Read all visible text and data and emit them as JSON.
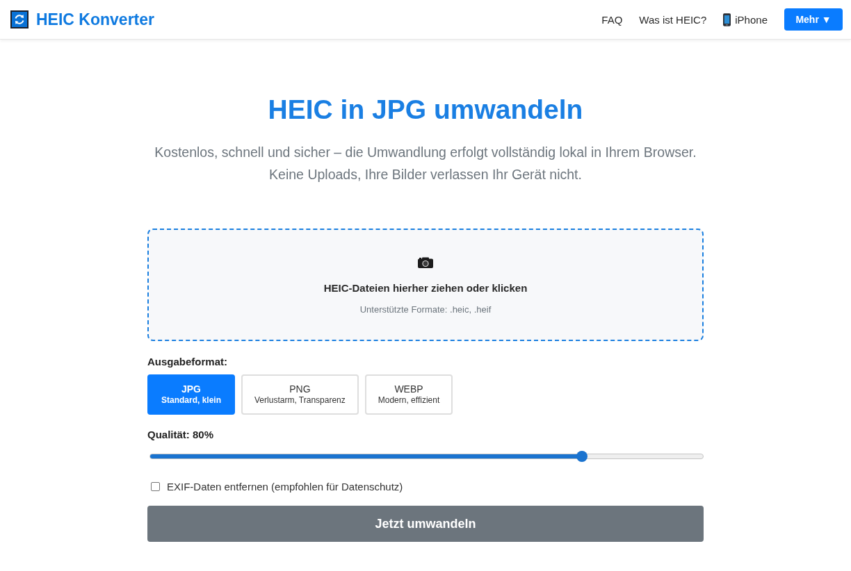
{
  "header": {
    "title": "HEIC Konverter",
    "nav": [
      {
        "label": "FAQ",
        "kind": "link"
      },
      {
        "label": "Was ist HEIC?",
        "kind": "link"
      },
      {
        "label": "iPhone",
        "kind": "phone-link"
      },
      {
        "label": "Mehr ▼",
        "kind": "button"
      }
    ]
  },
  "hero": {
    "title": "HEIC in JPG umwandeln",
    "subtitle": "Kostenlos, schnell und sicher – die Umwandlung erfolgt vollständig lokal in Ihrem Browser. Keine Uploads, Ihre Bilder verlassen Ihr Gerät nicht."
  },
  "dropzone": {
    "title": "HEIC-Dateien hierher ziehen oder klicken",
    "hint": "Unterstützte Formate: .heic, .heif"
  },
  "output_format": {
    "label": "Ausgabeformat:",
    "options": [
      {
        "name": "JPG",
        "description": "Standard, klein",
        "selected": true
      },
      {
        "name": "PNG",
        "description": "Verlustarm, Transparenz",
        "selected": false
      },
      {
        "name": "WEBP",
        "description": "Modern, effizient",
        "selected": false
      }
    ]
  },
  "quality": {
    "label": "Qualität: 80%",
    "level": 0.78
  },
  "exif": {
    "label": "EXIF-Daten entfernen (empfohlen für Datenschutz)",
    "checked": false
  },
  "convert_button": {
    "label": "Jetzt umwandeln",
    "disabled": true
  }
}
